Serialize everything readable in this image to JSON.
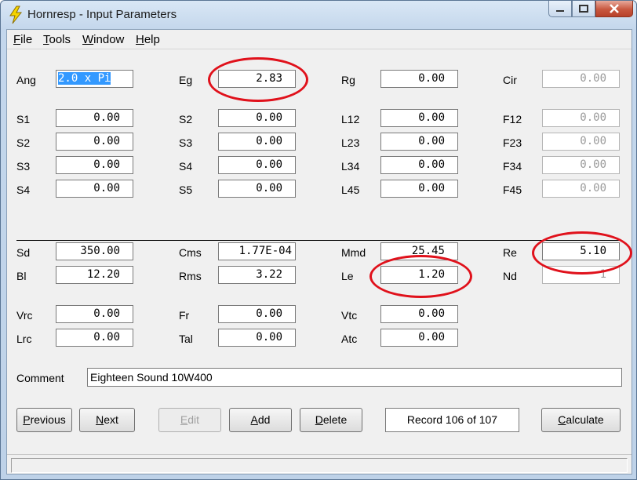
{
  "window": {
    "title": "Hornresp - Input Parameters"
  },
  "menu": [
    {
      "key": "F",
      "rest": "ile"
    },
    {
      "key": "T",
      "rest": "ools"
    },
    {
      "key": "W",
      "rest": "indow"
    },
    {
      "key": "H",
      "rest": "elp"
    }
  ],
  "fields": {
    "ang": {
      "label": "Ang",
      "value": "2.0 x Pi"
    },
    "eg": {
      "label": "Eg",
      "value": "2.83"
    },
    "rg": {
      "label": "Rg",
      "value": "0.00"
    },
    "cir": {
      "label": "Cir",
      "value": "0.00"
    },
    "s1": {
      "label": "S1",
      "value": "0.00"
    },
    "s2a": {
      "label": "S2",
      "value": "0.00"
    },
    "s3a": {
      "label": "S3",
      "value": "0.00"
    },
    "s4a": {
      "label": "S4",
      "value": "0.00"
    },
    "s2b": {
      "label": "S2",
      "value": "0.00"
    },
    "s3b": {
      "label": "S3",
      "value": "0.00"
    },
    "s4b": {
      "label": "S4",
      "value": "0.00"
    },
    "s5": {
      "label": "S5",
      "value": "0.00"
    },
    "l12": {
      "label": "L12",
      "value": "0.00"
    },
    "l23": {
      "label": "L23",
      "value": "0.00"
    },
    "l34": {
      "label": "L34",
      "value": "0.00"
    },
    "l45": {
      "label": "L45",
      "value": "0.00"
    },
    "f12": {
      "label": "F12",
      "value": "0.00"
    },
    "f23": {
      "label": "F23",
      "value": "0.00"
    },
    "f34": {
      "label": "F34",
      "value": "0.00"
    },
    "f45": {
      "label": "F45",
      "value": "0.00"
    },
    "sd": {
      "label": "Sd",
      "value": "350.00"
    },
    "bl": {
      "label": "Bl",
      "value": "12.20"
    },
    "cms": {
      "label": "Cms",
      "value": "1.77E-04"
    },
    "rms": {
      "label": "Rms",
      "value": "3.22"
    },
    "mmd": {
      "label": "Mmd",
      "value": "25.45"
    },
    "le": {
      "label": "Le",
      "value": "1.20"
    },
    "re": {
      "label": "Re",
      "value": "5.10"
    },
    "nd": {
      "label": "Nd",
      "value": "1"
    },
    "vrc": {
      "label": "Vrc",
      "value": "0.00"
    },
    "lrc": {
      "label": "Lrc",
      "value": "0.00"
    },
    "fr": {
      "label": "Fr",
      "value": "0.00"
    },
    "tal": {
      "label": "Tal",
      "value": "0.00"
    },
    "vtc": {
      "label": "Vtc",
      "value": "0.00"
    },
    "atc": {
      "label": "Atc",
      "value": "0.00"
    }
  },
  "comment": {
    "label": "Comment",
    "value": "Eighteen Sound 10W400"
  },
  "buttons": {
    "previous": {
      "key": "P",
      "rest": "revious"
    },
    "next": {
      "key": "N",
      "rest": "ext"
    },
    "edit": {
      "key": "E",
      "rest": "dit"
    },
    "add": {
      "key": "A",
      "rest": "dd"
    },
    "delete": {
      "key": "D",
      "rest": "elete"
    },
    "calculate": {
      "key": "C",
      "rest": "alculate"
    }
  },
  "record": "Record 106 of 107",
  "colors": {
    "highlight_circle": "#e0111b",
    "selection": "#3399ff"
  }
}
